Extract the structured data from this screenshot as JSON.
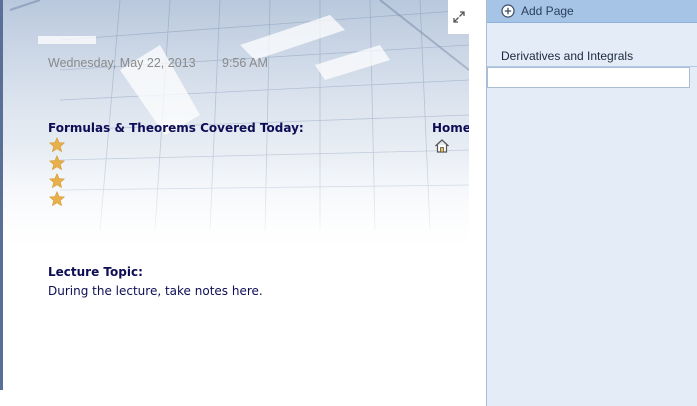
{
  "page": {
    "date": "Wednesday, May 22, 2013",
    "time": "9:56 AM",
    "formulas_heading": "Formulas & Theorems Covered Today:",
    "home_label": "Home",
    "lecture_topic_label": "Lecture Topic:",
    "lecture_note": "During the lecture, take notes here.",
    "star_count": 4,
    "icons": {
      "expand": "expand-icon",
      "home": "home-icon",
      "bullet": "star-icon"
    }
  },
  "pages_pane": {
    "add_page_label": "Add Page",
    "pages": [
      {
        "title": "Derivatives and Integrals"
      }
    ],
    "icons": {
      "add": "plus-circle-icon"
    }
  },
  "colors": {
    "heading_text": "#0d0d55",
    "timestamp_text": "#8a8a8a",
    "pane_background": "#e3ecf7",
    "add_page_bar": "#a6c4e6",
    "star": "#e8b04a"
  }
}
